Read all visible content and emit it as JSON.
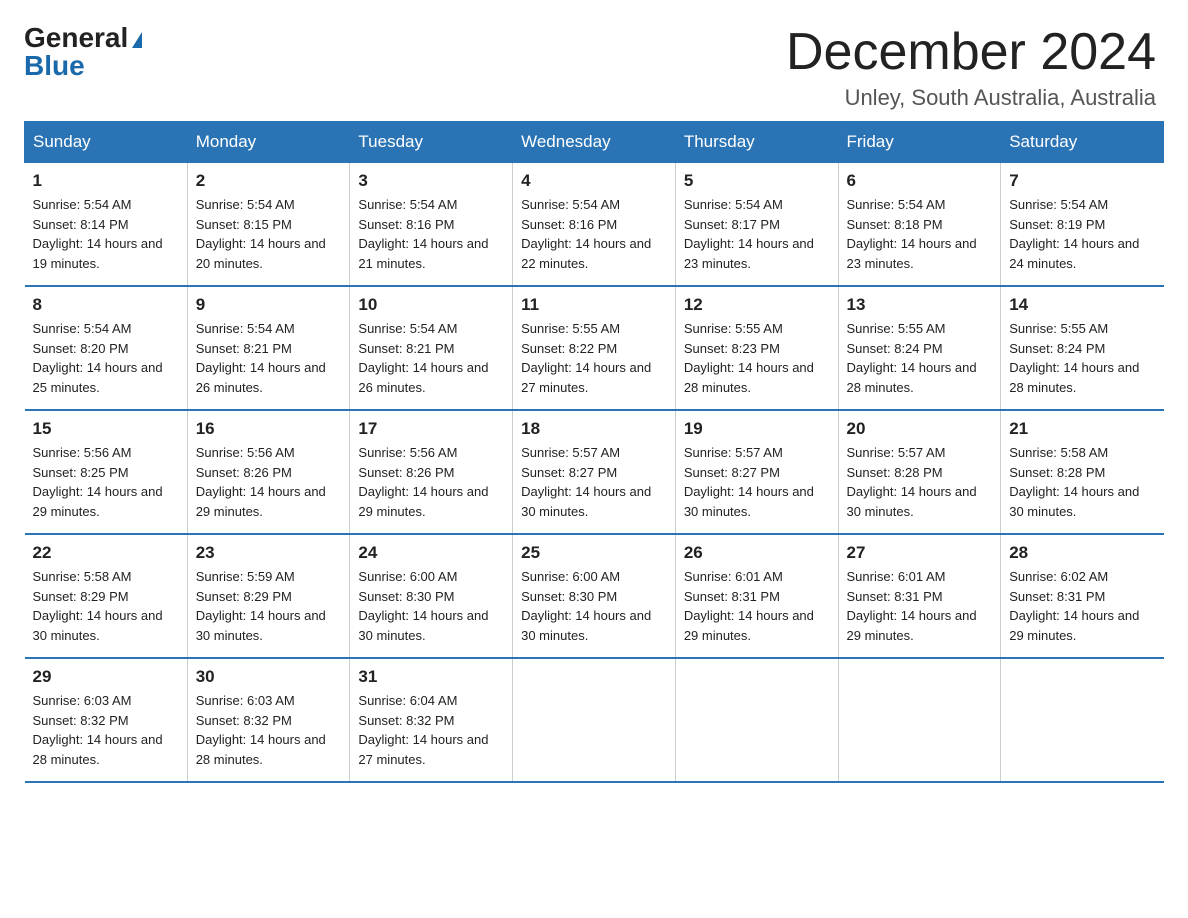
{
  "header": {
    "logo_general": "General",
    "logo_blue": "Blue",
    "month_title": "December 2024",
    "location": "Unley, South Australia, Australia"
  },
  "days_of_week": [
    "Sunday",
    "Monday",
    "Tuesday",
    "Wednesday",
    "Thursday",
    "Friday",
    "Saturday"
  ],
  "weeks": [
    [
      {
        "day": "1",
        "sunrise": "5:54 AM",
        "sunset": "8:14 PM",
        "daylight": "14 hours and 19 minutes."
      },
      {
        "day": "2",
        "sunrise": "5:54 AM",
        "sunset": "8:15 PM",
        "daylight": "14 hours and 20 minutes."
      },
      {
        "day": "3",
        "sunrise": "5:54 AM",
        "sunset": "8:16 PM",
        "daylight": "14 hours and 21 minutes."
      },
      {
        "day": "4",
        "sunrise": "5:54 AM",
        "sunset": "8:16 PM",
        "daylight": "14 hours and 22 minutes."
      },
      {
        "day": "5",
        "sunrise": "5:54 AM",
        "sunset": "8:17 PM",
        "daylight": "14 hours and 23 minutes."
      },
      {
        "day": "6",
        "sunrise": "5:54 AM",
        "sunset": "8:18 PM",
        "daylight": "14 hours and 23 minutes."
      },
      {
        "day": "7",
        "sunrise": "5:54 AM",
        "sunset": "8:19 PM",
        "daylight": "14 hours and 24 minutes."
      }
    ],
    [
      {
        "day": "8",
        "sunrise": "5:54 AM",
        "sunset": "8:20 PM",
        "daylight": "14 hours and 25 minutes."
      },
      {
        "day": "9",
        "sunrise": "5:54 AM",
        "sunset": "8:21 PM",
        "daylight": "14 hours and 26 minutes."
      },
      {
        "day": "10",
        "sunrise": "5:54 AM",
        "sunset": "8:21 PM",
        "daylight": "14 hours and 26 minutes."
      },
      {
        "day": "11",
        "sunrise": "5:55 AM",
        "sunset": "8:22 PM",
        "daylight": "14 hours and 27 minutes."
      },
      {
        "day": "12",
        "sunrise": "5:55 AM",
        "sunset": "8:23 PM",
        "daylight": "14 hours and 28 minutes."
      },
      {
        "day": "13",
        "sunrise": "5:55 AM",
        "sunset": "8:24 PM",
        "daylight": "14 hours and 28 minutes."
      },
      {
        "day": "14",
        "sunrise": "5:55 AM",
        "sunset": "8:24 PM",
        "daylight": "14 hours and 28 minutes."
      }
    ],
    [
      {
        "day": "15",
        "sunrise": "5:56 AM",
        "sunset": "8:25 PM",
        "daylight": "14 hours and 29 minutes."
      },
      {
        "day": "16",
        "sunrise": "5:56 AM",
        "sunset": "8:26 PM",
        "daylight": "14 hours and 29 minutes."
      },
      {
        "day": "17",
        "sunrise": "5:56 AM",
        "sunset": "8:26 PM",
        "daylight": "14 hours and 29 minutes."
      },
      {
        "day": "18",
        "sunrise": "5:57 AM",
        "sunset": "8:27 PM",
        "daylight": "14 hours and 30 minutes."
      },
      {
        "day": "19",
        "sunrise": "5:57 AM",
        "sunset": "8:27 PM",
        "daylight": "14 hours and 30 minutes."
      },
      {
        "day": "20",
        "sunrise": "5:57 AM",
        "sunset": "8:28 PM",
        "daylight": "14 hours and 30 minutes."
      },
      {
        "day": "21",
        "sunrise": "5:58 AM",
        "sunset": "8:28 PM",
        "daylight": "14 hours and 30 minutes."
      }
    ],
    [
      {
        "day": "22",
        "sunrise": "5:58 AM",
        "sunset": "8:29 PM",
        "daylight": "14 hours and 30 minutes."
      },
      {
        "day": "23",
        "sunrise": "5:59 AM",
        "sunset": "8:29 PM",
        "daylight": "14 hours and 30 minutes."
      },
      {
        "day": "24",
        "sunrise": "6:00 AM",
        "sunset": "8:30 PM",
        "daylight": "14 hours and 30 minutes."
      },
      {
        "day": "25",
        "sunrise": "6:00 AM",
        "sunset": "8:30 PM",
        "daylight": "14 hours and 30 minutes."
      },
      {
        "day": "26",
        "sunrise": "6:01 AM",
        "sunset": "8:31 PM",
        "daylight": "14 hours and 29 minutes."
      },
      {
        "day": "27",
        "sunrise": "6:01 AM",
        "sunset": "8:31 PM",
        "daylight": "14 hours and 29 minutes."
      },
      {
        "day": "28",
        "sunrise": "6:02 AM",
        "sunset": "8:31 PM",
        "daylight": "14 hours and 29 minutes."
      }
    ],
    [
      {
        "day": "29",
        "sunrise": "6:03 AM",
        "sunset": "8:32 PM",
        "daylight": "14 hours and 28 minutes."
      },
      {
        "day": "30",
        "sunrise": "6:03 AM",
        "sunset": "8:32 PM",
        "daylight": "14 hours and 28 minutes."
      },
      {
        "day": "31",
        "sunrise": "6:04 AM",
        "sunset": "8:32 PM",
        "daylight": "14 hours and 27 minutes."
      },
      {
        "day": "",
        "sunrise": "",
        "sunset": "",
        "daylight": ""
      },
      {
        "day": "",
        "sunrise": "",
        "sunset": "",
        "daylight": ""
      },
      {
        "day": "",
        "sunrise": "",
        "sunset": "",
        "daylight": ""
      },
      {
        "day": "",
        "sunrise": "",
        "sunset": "",
        "daylight": ""
      }
    ]
  ],
  "labels": {
    "sunrise_prefix": "Sunrise: ",
    "sunset_prefix": "Sunset: ",
    "daylight_prefix": "Daylight: "
  }
}
